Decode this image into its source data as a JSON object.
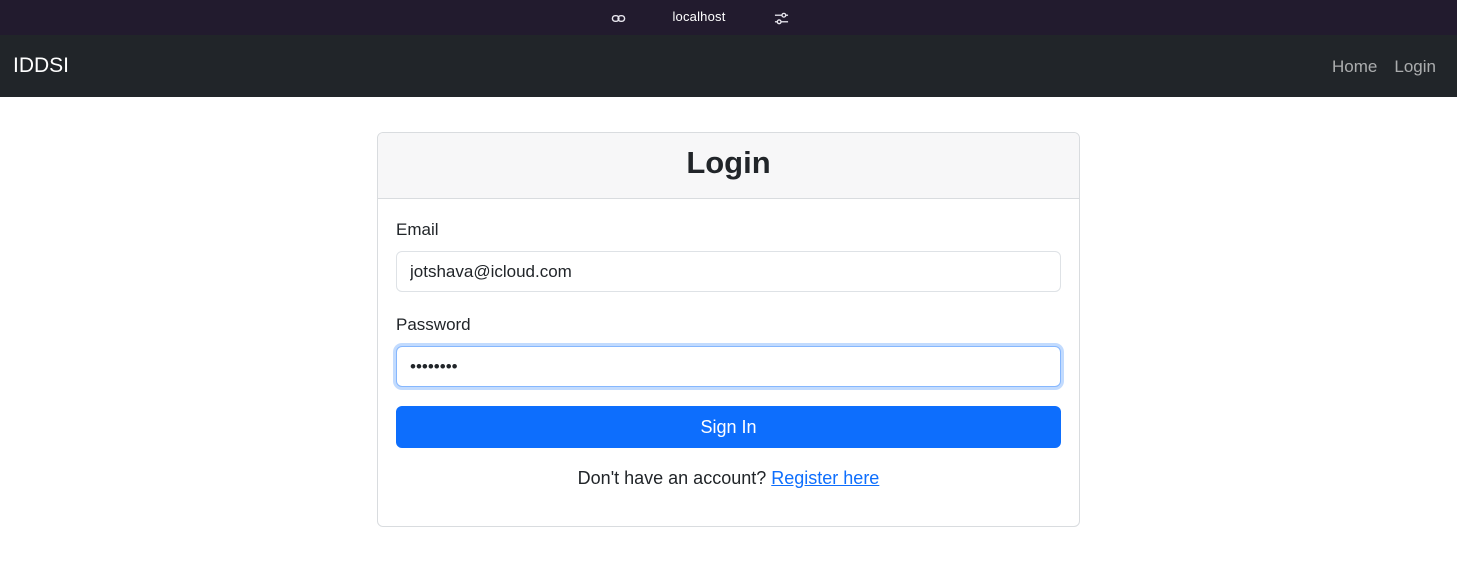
{
  "browser": {
    "host": "localhost",
    "icons": [
      "link-icon",
      "tune-icon"
    ],
    "bar_color": "#221b2e"
  },
  "navbar": {
    "brand": "IDDSI",
    "links": [
      {
        "label": "Home"
      },
      {
        "label": "Login"
      }
    ],
    "background": "#212529"
  },
  "login_card": {
    "title": "Login",
    "email": {
      "label": "Email",
      "value": "jotshava@icloud.com"
    },
    "password": {
      "label": "Password",
      "value": "••••••••"
    },
    "submit_label": "Sign In",
    "register_prompt": "Don't have an account?",
    "register_link": "Register here",
    "accent_color": "#0d6efd"
  }
}
